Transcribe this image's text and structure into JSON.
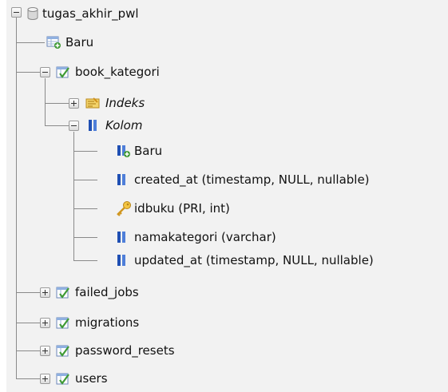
{
  "tree": {
    "database": {
      "name": "tugas_akhir_pwl",
      "icon": "database-icon"
    },
    "new_table": {
      "label": "Baru",
      "icon": "new-table-icon"
    },
    "tables": [
      {
        "name": "book_kategori",
        "icon": "table-icon",
        "expanded": true
      },
      {
        "name": "failed_jobs",
        "icon": "table-icon",
        "expanded": false
      },
      {
        "name": "migrations",
        "icon": "table-icon",
        "expanded": false
      },
      {
        "name": "password_resets",
        "icon": "table-icon",
        "expanded": false
      },
      {
        "name": "users",
        "icon": "table-icon",
        "expanded": false
      }
    ],
    "indexes": {
      "label": "Indeks",
      "icon": "index-icon",
      "expanded": false
    },
    "columns": {
      "label": "Kolom",
      "icon": "columns-icon",
      "expanded": true,
      "new_column": {
        "label": "Baru",
        "icon": "new-column-icon"
      },
      "items": [
        {
          "label": "created_at (timestamp, NULL, nullable)",
          "icon": "column-icon"
        },
        {
          "label": "idbuku (PRI, int)",
          "icon": "primary-key-icon"
        },
        {
          "label": "namakategori (varchar)",
          "icon": "column-icon"
        },
        {
          "label": "updated_at (timestamp, NULL, nullable)",
          "icon": "column-icon"
        }
      ]
    }
  },
  "colors": {
    "tree_background": "#f2f2f2",
    "connector_line": "#8a8a8a",
    "column_icon_blue": "#1f4fb3",
    "table_icon_green": "#3f9a35",
    "key_icon_gold": "#e0a82a"
  }
}
